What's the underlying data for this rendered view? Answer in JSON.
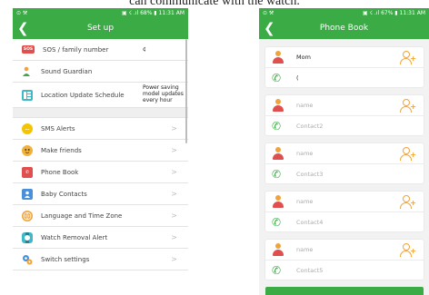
{
  "caption": "can communicate with the watch.",
  "colors": {
    "brand_green": "#3aab45",
    "accent_orange": "#f0a33a",
    "sos_red": "#e04e4e"
  },
  "left": {
    "status": {
      "left_icons": "⊙ ⚒",
      "right": "▣ ☇ .ıl 68% ▮ 11:31 AM"
    },
    "title": "Set up",
    "items": [
      {
        "label": "SOS / family number",
        "icon": "sos-icon",
        "value": "¢"
      },
      {
        "label": "Sound Guardian",
        "icon": "sound-guardian-icon"
      },
      {
        "label": "Location Update Schedule",
        "icon": "location-schedule-icon",
        "value": "Power saving model updates every hour"
      },
      {
        "label": "SMS Alerts",
        "icon": "sms-icon"
      },
      {
        "label": "Make friends",
        "icon": "friends-icon"
      },
      {
        "label": "Phone Book",
        "icon": "phone-book-icon"
      },
      {
        "label": "Baby Contacts",
        "icon": "baby-contacts-icon"
      },
      {
        "label": "Language and Time Zone",
        "icon": "language-icon"
      },
      {
        "label": "Watch Removal Alert",
        "icon": "watch-removal-icon"
      },
      {
        "label": "Switch settings",
        "icon": "switch-settings-icon"
      }
    ],
    "chevron": ">"
  },
  "right": {
    "status": {
      "left_icons": "⊙ ⚒",
      "right": "▣ ☇ .ıl 67% ▮ 11:31 AM"
    },
    "title": "Phone Book",
    "contacts": [
      {
        "name": "Mom",
        "number": "("
      },
      {
        "name_placeholder": "name",
        "number_placeholder": "Contact2"
      },
      {
        "name_placeholder": "name",
        "number_placeholder": "Contact3"
      },
      {
        "name_placeholder": "name",
        "number_placeholder": "Contact4"
      },
      {
        "name_placeholder": "name",
        "number_placeholder": "Contact5"
      }
    ]
  }
}
